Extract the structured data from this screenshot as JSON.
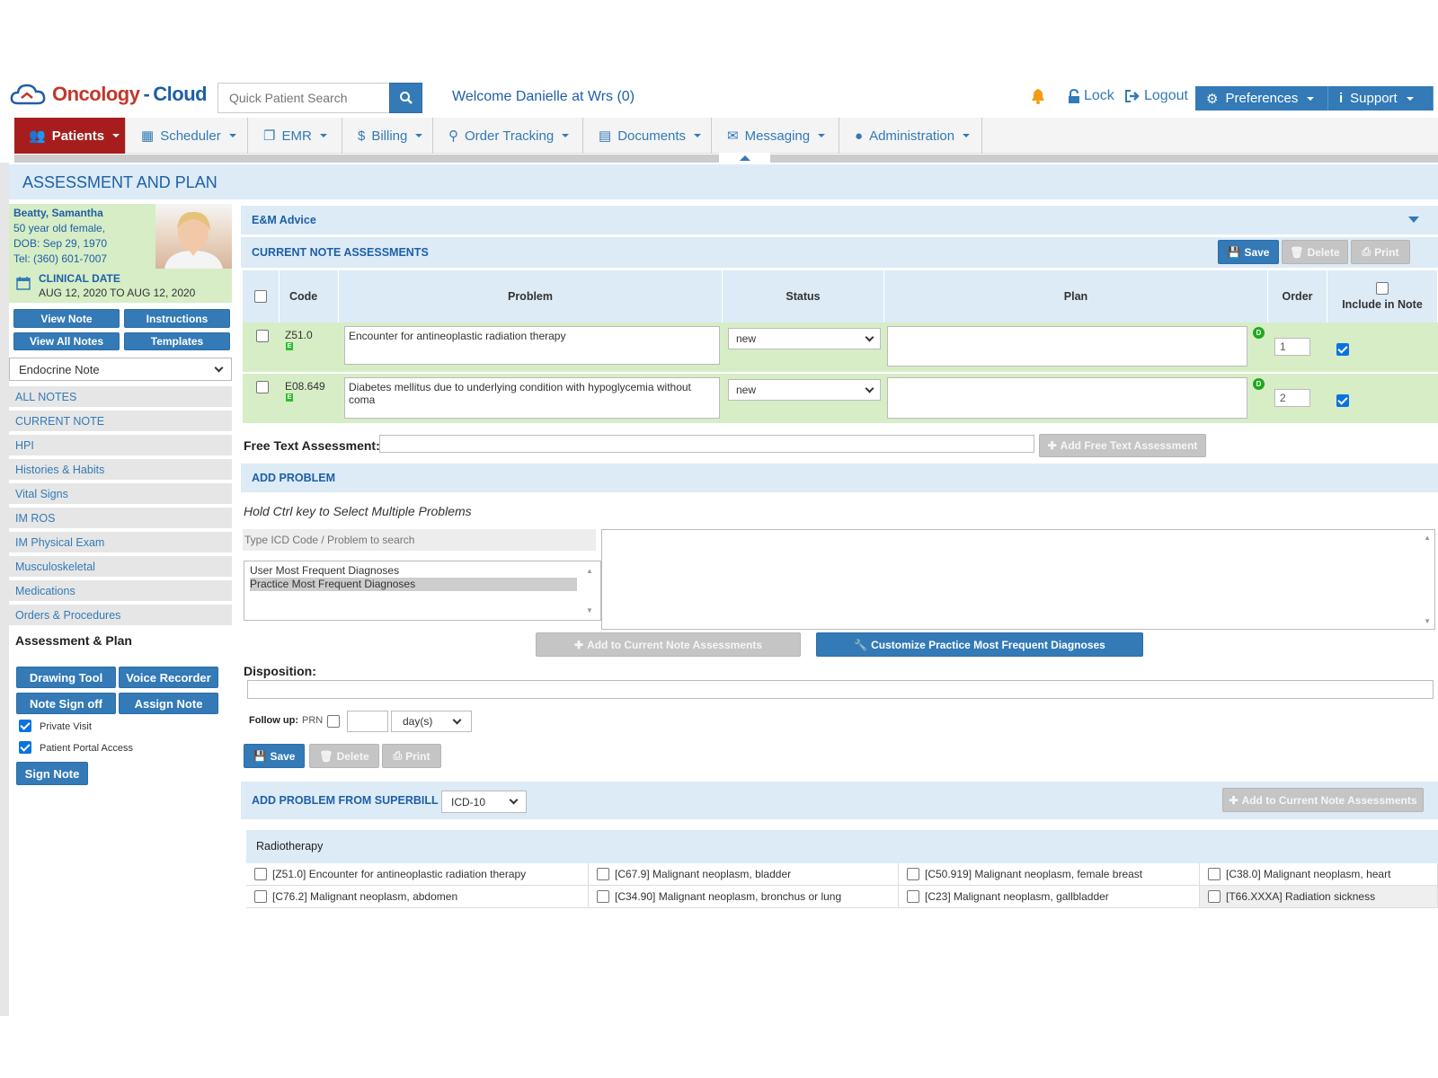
{
  "header": {
    "logo_part1": "Oncology",
    "logo_dash": "-",
    "logo_part2": "Cloud",
    "search_placeholder": "Quick Patient Search",
    "welcome": "Welcome Danielle at Wrs (0)",
    "lock": "Lock",
    "logout": "Logout",
    "preferences": "Preferences",
    "support": "Support"
  },
  "nav": {
    "patients": "Patients",
    "scheduler": "Scheduler",
    "emr": "EMR",
    "billing": "Billing",
    "order_tracking": "Order Tracking",
    "documents": "Documents",
    "messaging": "Messaging",
    "administration": "Administration"
  },
  "page_title": "ASSESSMENT AND PLAN",
  "patient": {
    "name": "Beatty, Samantha",
    "age_sex": "50 year old female,",
    "dob": "DOB: Sep 29, 1970",
    "tel": "Tel: (360) 601-7007",
    "clinical_date_label": "CLINICAL DATE",
    "clinical_date_value": "AUG 12, 2020 TO AUG 12, 2020"
  },
  "sidebar": {
    "view_note": "View Note",
    "instructions": "Instructions",
    "view_all_notes": "View All Notes",
    "templates": "Templates",
    "note_type": "Endocrine Note",
    "items": [
      "ALL NOTES",
      "CURRENT NOTE",
      "HPI",
      "Histories & Habits",
      "Vital Signs",
      "IM ROS",
      "IM Physical Exam",
      "Musculoskeletal",
      "Medications",
      "Orders & Procedures"
    ],
    "active_item": "Assessment & Plan",
    "drawing_tool": "Drawing Tool",
    "voice_recorder": "Voice Recorder",
    "note_sign_off": "Note Sign off",
    "assign_note": "Assign Note",
    "private_visit": "Private Visit",
    "private_visit_checked": true,
    "patient_portal_access": "Patient Portal Access",
    "patient_portal_checked": true,
    "sign_note": "Sign Note"
  },
  "em_advice": "E&M Advice",
  "current_assessments": {
    "title": "CURRENT NOTE ASSESSMENTS",
    "save": "Save",
    "delete": "Delete",
    "print": "Print",
    "columns": {
      "code": "Code",
      "problem": "Problem",
      "status": "Status",
      "plan": "Plan",
      "order": "Order",
      "include": "Include in Note"
    },
    "rows": [
      {
        "code": "Z51.0",
        "badge": "E",
        "problem": "Encounter for antineoplastic radiation therapy",
        "status": "new",
        "plan": "",
        "order": "1",
        "plan_badge": "D",
        "include": true
      },
      {
        "code": "E08.649",
        "badge": "E",
        "problem": "Diabetes mellitus due to underlying condition with hypoglycemia without coma",
        "status": "new",
        "plan": "",
        "order": "2",
        "plan_badge": "D",
        "include": true
      }
    ]
  },
  "free_text": {
    "label": "Free Text Assessment:",
    "value": "",
    "add_button": "Add Free Text Assessment"
  },
  "add_problem": {
    "title": "ADD PROBLEM",
    "hint": "Hold Ctrl key to Select Multiple Problems",
    "search_placeholder": "Type ICD Code / Problem to search",
    "list": [
      "User Most Frequent Diagnoses",
      "Practice Most Frequent Diagnoses"
    ],
    "selected": "Practice Most Frequent Diagnoses",
    "add_button": "Add to Current Note Assessments",
    "customize_button": "Customize Practice Most Frequent Diagnoses"
  },
  "disposition": {
    "label": "Disposition:",
    "value": "",
    "followup_label": "Follow up:",
    "prn": "PRN",
    "followup_value": "",
    "followup_unit": "day(s)",
    "save": "Save",
    "delete": "Delete",
    "print": "Print"
  },
  "superbill": {
    "title": "ADD PROBLEM FROM SUPERBILL",
    "code_set": "ICD-10",
    "add_button": "Add to Current Note Assessments",
    "group": "Radiotherapy",
    "items": [
      "[Z51.0] Encounter for antineoplastic radiation therapy",
      "[C67.9] Malignant neoplasm, bladder",
      "[C50.919] Malignant neoplasm, female breast",
      "[C38.0] Malignant neoplasm, heart",
      "[C76.2] Malignant neoplasm, abdomen",
      "[C34.90] Malignant neoplasm, bronchus or lung",
      "[C23] Malignant neoplasm, gallbladder",
      "[T66.XXXA] Radiation sickness"
    ]
  },
  "colors": {
    "brand_blue": "#337ab7",
    "brand_red": "#a71d1d",
    "section_bg": "#dcebf6",
    "row_green": "#d6edc6"
  }
}
